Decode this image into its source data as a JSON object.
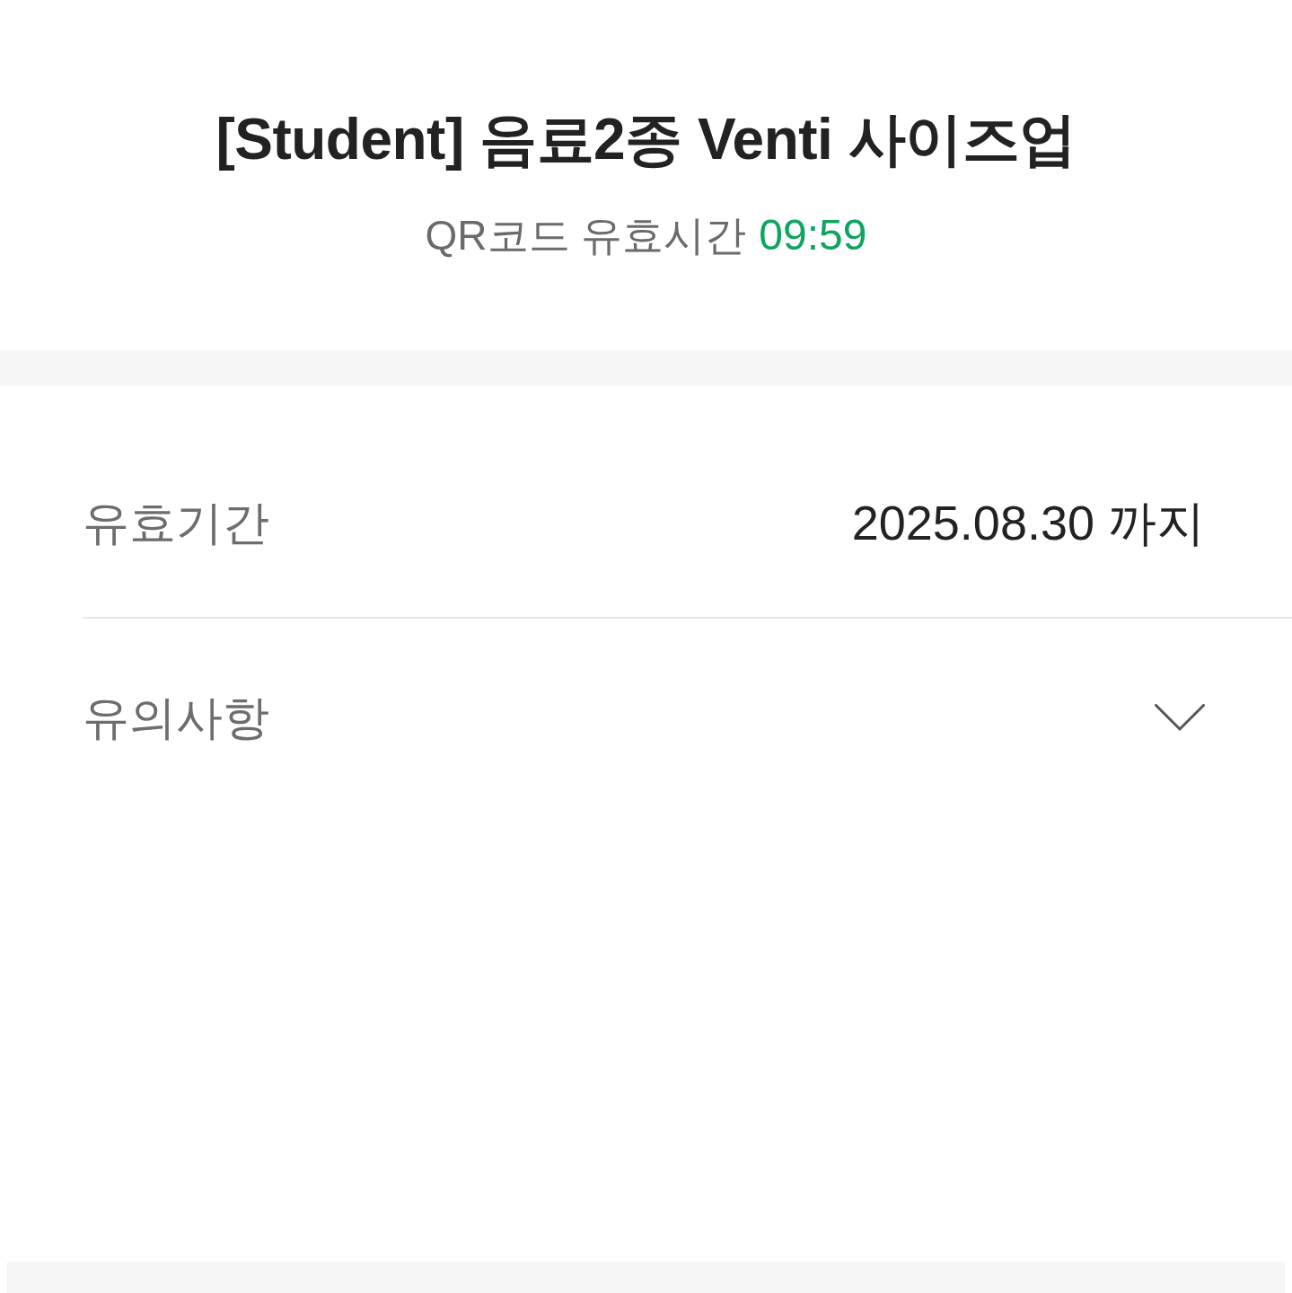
{
  "header": {
    "title": "[Student] 음료2종 Venti 사이즈업",
    "qr_validity": {
      "label": "QR코드 유효시간",
      "time": "09:59"
    }
  },
  "details": [
    {
      "kind": "info",
      "label": "유효기간",
      "value": "2025.08.30 까지"
    },
    {
      "kind": "expandable",
      "label": "유의사항",
      "expanded": false
    }
  ]
}
